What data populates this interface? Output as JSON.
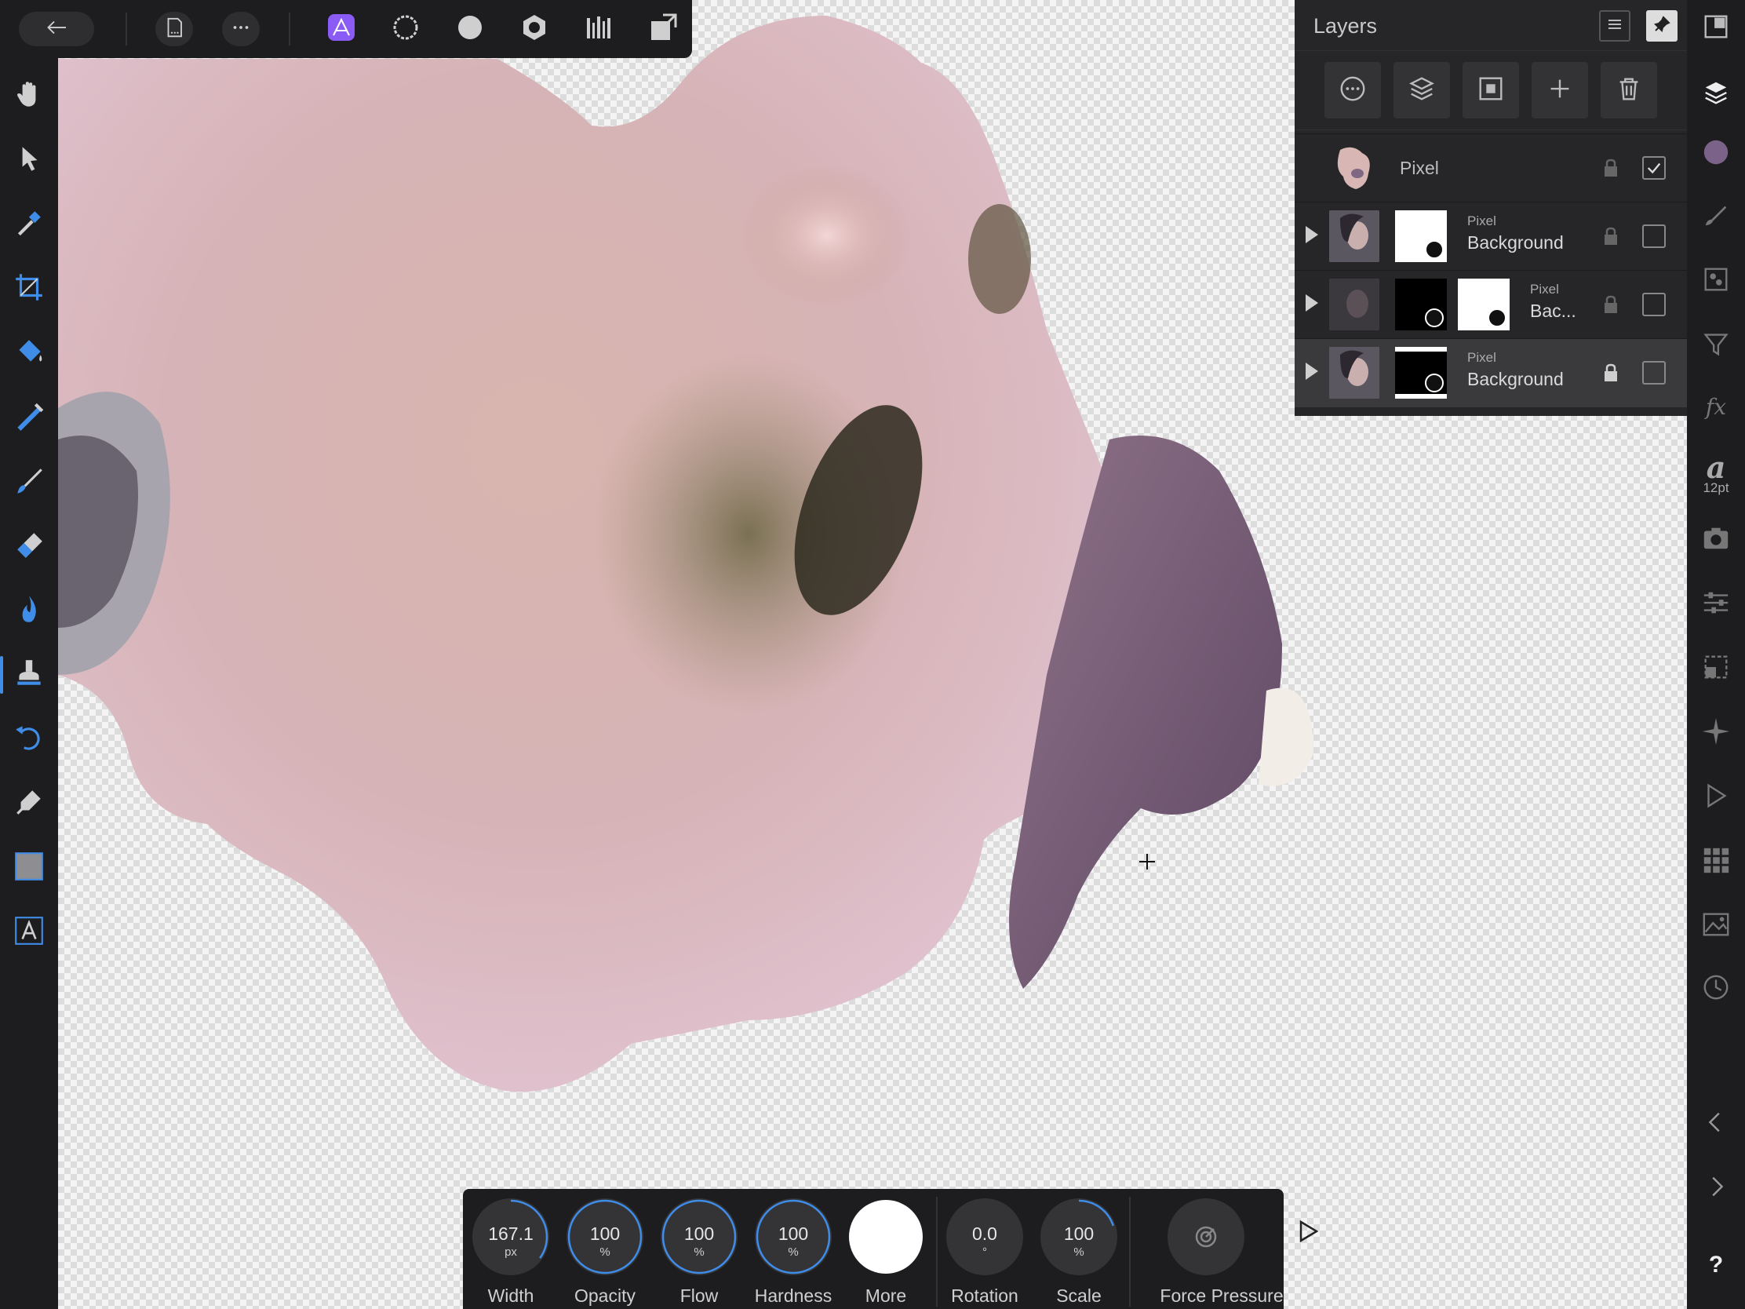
{
  "top_toolbar": {
    "back_icon": "back-arrow-icon",
    "document_icon": "document-icon",
    "more_icon": "more-icon",
    "personas": [
      {
        "name": "photo-persona-icon",
        "color": "#8a5cf5"
      },
      {
        "name": "liquify-persona-icon"
      },
      {
        "name": "develop-persona-icon"
      },
      {
        "name": "tone-mapping-persona-icon"
      },
      {
        "name": "export-persona-icon"
      },
      {
        "name": "share-icon"
      }
    ]
  },
  "layers_panel": {
    "title": "Layers",
    "layers": [
      {
        "type": "Pixel",
        "name": "",
        "selected": false,
        "visible": true,
        "locked": false
      },
      {
        "type": "Pixel",
        "name": "Background",
        "selected": false,
        "visible": false,
        "locked": false
      },
      {
        "type": "Pixel",
        "name": "Bac...",
        "selected": false,
        "visible": false,
        "locked": false
      },
      {
        "type": "Pixel",
        "name": "Background",
        "selected": true,
        "visible": false,
        "locked": true
      }
    ]
  },
  "right_strip": {
    "text_size": "12pt",
    "color_swatch": "#7a6288",
    "help": "?"
  },
  "brush_context": {
    "width": {
      "value": "167.1",
      "unit": "px",
      "label": "Width",
      "fraction": 0.35
    },
    "opacity": {
      "value": "100",
      "unit": "%",
      "label": "Opacity",
      "fraction": 1.0
    },
    "flow": {
      "value": "100",
      "unit": "%",
      "label": "Flow",
      "fraction": 1.0
    },
    "hardness": {
      "value": "100",
      "unit": "%",
      "label": "Hardness",
      "fraction": 1.0
    },
    "more": {
      "label": "More"
    },
    "rotation": {
      "value": "0.0",
      "unit": "°",
      "label": "Rotation",
      "fraction": 0.0
    },
    "scale": {
      "value": "100",
      "unit": "%",
      "label": "Scale",
      "fraction": 0.2
    },
    "force_pressure": {
      "label": "Force Pressure"
    }
  },
  "colors": {
    "accent": "#3f8de8",
    "persona_active": "#8a5cf5"
  }
}
